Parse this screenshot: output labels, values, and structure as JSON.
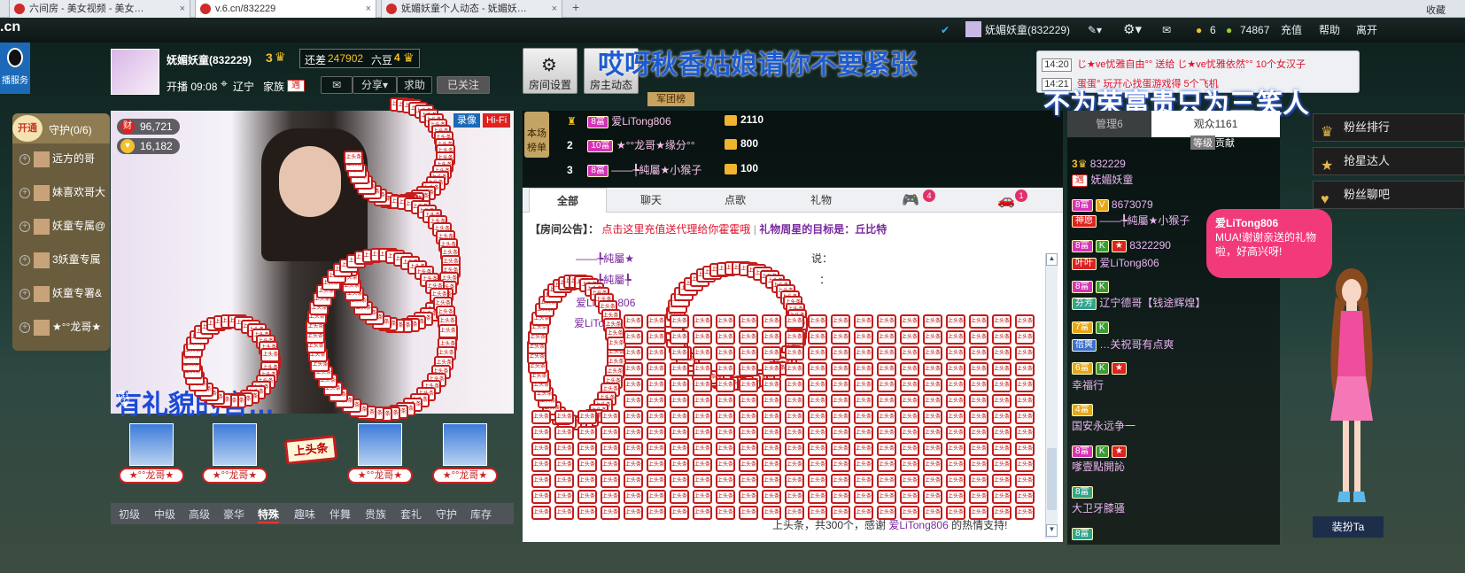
{
  "browser": {
    "tabs": [
      {
        "title": "六间房 - 美女视频 - 美女…"
      },
      {
        "title": "v.6.cn/832229"
      },
      {
        "title": "妩媚妖童个人动态 - 妩媚妖…"
      }
    ],
    "new_tab": "+",
    "right_label": "收藏"
  },
  "topnav": {
    "logo": ".cn",
    "user": "妩媚妖童(832229)",
    "coins": "6",
    "beans": "74867",
    "recharge": "充值",
    "help": "帮助",
    "leave": "离开"
  },
  "service": "播服务",
  "host": {
    "name": "妩媚妖童(832229)",
    "level": "3",
    "need_label": "还差",
    "need_value": "247902",
    "next_level": "六豆",
    "level_next_num": "4",
    "start_label": "开播 09:08",
    "location": "辽宁",
    "family_label": "家族",
    "family_badge": "遇",
    "share": "分享",
    "ask": "求助",
    "followed": "已关注",
    "room_settings": "房间设置",
    "host_dynamic": "房主动态",
    "army": "军团榜"
  },
  "headline": "哎呀秋香姑娘请你不要紧张",
  "guard": {
    "open": "开通",
    "title": "守护(0/6)",
    "members": [
      "远方的哥",
      "妹喜欢哥大",
      "妖童专属@",
      "3妖童专属",
      "妖童专署&",
      "★°°龙哥★"
    ]
  },
  "video": {
    "wealth": "96,721",
    "likes": "16,182",
    "record": "录像",
    "hifi": "Hi-Fi",
    "caption": "有礼貌的官…"
  },
  "seats": [
    "★°°龙哥★",
    "★°°龙哥★",
    "★°°龙哥★",
    "★°°龙哥★"
  ],
  "top_sign": "上头条",
  "board_text": "上头条",
  "gift_tabs": [
    "初级",
    "中级",
    "高级",
    "豪华",
    "特殊",
    "趣味",
    "伴舞",
    "贵族",
    "套礼",
    "守护",
    "库存"
  ],
  "gift_tab_active": "特殊",
  "ranking": {
    "label": "本场榜单",
    "rows": [
      {
        "rank": "",
        "level": "8富",
        "name": "爱LiTong806",
        "value": "2110"
      },
      {
        "rank": "2",
        "level": "10富",
        "name": "★°°龙哥★缘分°°",
        "value": "800"
      },
      {
        "rank": "3",
        "level": "8富",
        "name": "——╄純屬★小猴子",
        "value": "100"
      }
    ]
  },
  "chat": {
    "tabs": [
      "全部",
      "聊天",
      "点歌",
      "礼物"
    ],
    "game_count": "4",
    "car_count": "1",
    "notice_label": "【房间公告】：",
    "notice_link": "点击这里充值送代理给你霍霍哦",
    "notice_gift": "礼物周星的目标是：丘比特",
    "lines": [
      {
        "name": "——╄純屬★",
        "suffix": "说："
      },
      {
        "name": "——╄純屬╄",
        "suffix": "："
      },
      {
        "name": "爱LiTong806",
        "suffix": ""
      },
      {
        "name": "爱LiTong",
        "suffix": ""
      }
    ],
    "final_prefix": "上头条，共300个，感谢",
    "final_name": "爱LiTong806",
    "final_suffix": "的热情支持!"
  },
  "gift_news": [
    {
      "time": "14:20",
      "text": "じ★ve忧雅自由°° 送给 じ★ve忧雅依然°° 10个女汉子"
    },
    {
      "time": "14:21",
      "text": "蛋蛋° 玩开心找蛋游戏得 5个飞机"
    }
  ],
  "slogan": "不为荣富贵只为三笑人",
  "users": {
    "manage_tab": "管理6",
    "audience_tab": "观众1161",
    "sub_tabs": [
      "等级",
      "贡献"
    ],
    "list": [
      {
        "level": "3",
        "id": "832229",
        "badge": "遇",
        "name": "妩媚妖童"
      },
      {
        "level": "8富",
        "id": "8673079",
        "badge": "神愿",
        "name": "——╄純屬★小猴子"
      },
      {
        "level": "8富",
        "id": "8322290",
        "badge": "叶叶",
        "name": "爱LiTong806"
      },
      {
        "level": "8富",
        "id": "",
        "badge": "芬芳",
        "name": "辽宁德哥【钱途辉煌】"
      },
      {
        "level": "7富",
        "id": "",
        "badge": "倍爽",
        "name": "…关祝哥有点爽"
      },
      {
        "level": "6富",
        "id": "",
        "badge": "",
        "name": "幸福行"
      },
      {
        "level": "4富",
        "id": "",
        "badge": "",
        "name": "国安永远争一"
      },
      {
        "level": "8富",
        "id": "",
        "badge": "",
        "name": "嗲壹點開訫"
      },
      {
        "level": "8富",
        "id": "",
        "badge": "",
        "name": "大卫牙膝骚"
      },
      {
        "level": "8富",
        "id": "",
        "badge": "",
        "name": ""
      }
    ]
  },
  "side_buttons": [
    "粉丝排行",
    "抢星达人",
    "粉丝聊吧"
  ],
  "bubble": {
    "name": "爱LiTong806",
    "text": "MUA!谢谢亲送的礼物啦，好高兴呀!"
  },
  "dress_up": "装扮Ta",
  "colors": {
    "accent": "#c51c1c",
    "headline": "#1e5bd0",
    "chat_red": "#e0102a"
  }
}
